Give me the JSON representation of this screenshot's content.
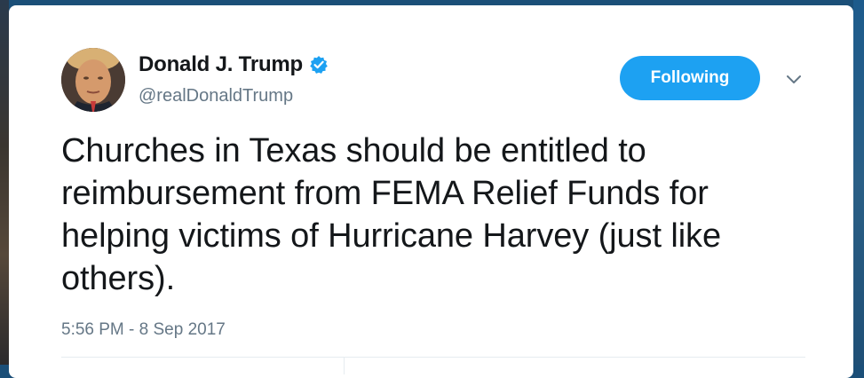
{
  "tweet": {
    "author": {
      "display_name": "Donald J. Trump",
      "handle": "@realDonaldTrump",
      "verified": true
    },
    "follow_button_label": "Following",
    "text": "Churches in Texas should be entitled to reimbursement from FEMA Relief Funds for helping victims of Hurricane Harvey (just like others).",
    "timestamp": "5:56 PM - 8 Sep 2017"
  },
  "colors": {
    "accent": "#1da1f2",
    "text_primary": "#14171a",
    "text_secondary": "#657786",
    "divider": "#e6ecf0"
  },
  "icons": {
    "verified": "verified-badge-icon",
    "menu": "chevron-down-icon",
    "avatar": "avatar"
  }
}
